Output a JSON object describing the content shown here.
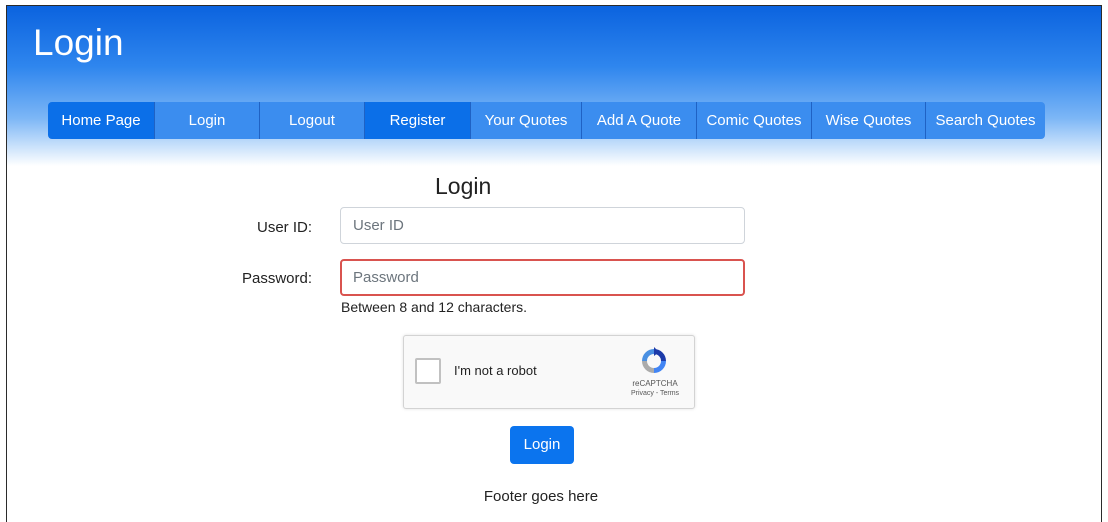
{
  "header": {
    "title": "Login"
  },
  "nav": {
    "items": [
      {
        "label": "Home Page",
        "active": true
      },
      {
        "label": "Login",
        "active": false
      },
      {
        "label": "Logout",
        "active": false
      },
      {
        "label": "Register",
        "active": true
      },
      {
        "label": "Your Quotes",
        "active": false
      },
      {
        "label": "Add A Quote",
        "active": false
      },
      {
        "label": "Comic Quotes",
        "active": false
      },
      {
        "label": "Wise Quotes",
        "active": false
      },
      {
        "label": "Search Quotes",
        "active": false
      }
    ]
  },
  "form": {
    "title": "Login",
    "user_id_label": "User ID:",
    "user_id_placeholder": "User ID",
    "user_id_value": "",
    "password_label": "Password:",
    "password_placeholder": "Password",
    "password_value": "",
    "password_help": "Between 8 and 12 characters.",
    "submit_label": "Login"
  },
  "recaptcha": {
    "checkbox_label": "I'm not a robot",
    "brand": "reCAPTCHA",
    "links": "Privacy - Terms",
    "icon": "recaptcha-logo-icon"
  },
  "footer": {
    "text": "Footer goes here"
  },
  "colors": {
    "brand_blue": "#0b6fe8",
    "nav_blue": "#3b8def",
    "error_red": "#d9534f"
  }
}
